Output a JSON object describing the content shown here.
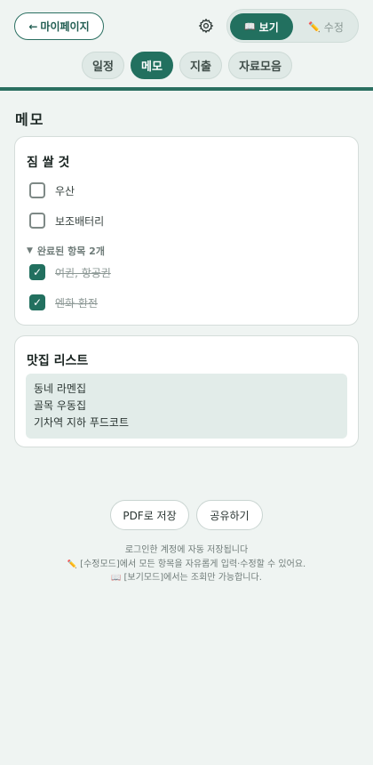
{
  "header": {
    "mypage_arrow": "←",
    "mypage_label": "마이페이지",
    "settings_icon": "gear-icon",
    "mode": {
      "view_icon": "📖",
      "view_label": "보기",
      "edit_icon": "✏️",
      "edit_label": "수정",
      "active": "view"
    }
  },
  "tabs": [
    {
      "label": "일정",
      "active": false
    },
    {
      "label": "메모",
      "active": true
    },
    {
      "label": "지출",
      "active": false
    },
    {
      "label": "자료모음",
      "active": false
    }
  ],
  "section_title": "메모",
  "packing_card": {
    "title": "짐 쌀 것",
    "items": [
      {
        "label": "우산",
        "checked": false
      },
      {
        "label": "보조배터리",
        "checked": false
      }
    ],
    "completed_header": "완료된 항목 2개",
    "completed_items": [
      {
        "label": "여권, 항공권",
        "checked": true
      },
      {
        "label": "엔화 환전",
        "checked": true
      }
    ]
  },
  "food_card": {
    "title": "맛집 리스트",
    "lines": [
      "동네 라멘집",
      "골목 우동집",
      "기차역 지하 푸드코트"
    ]
  },
  "actions": {
    "pdf_label": "PDF로 저장",
    "share_label": "공유하기"
  },
  "footer": {
    "line1": "로그인한 계정에 자동 저장됩니다",
    "line2_icon": "✏️",
    "line2": "[수정모드]에서 모든 항목을 자유롭게 입력·수정할 수 있어요.",
    "line3_icon": "📖",
    "line3": "[보기모드]에서는 조회만 가능합니다."
  },
  "colors": {
    "accent": "#22705f",
    "background": "#eff4f2",
    "pill_inactive": "#dfe9e6"
  }
}
